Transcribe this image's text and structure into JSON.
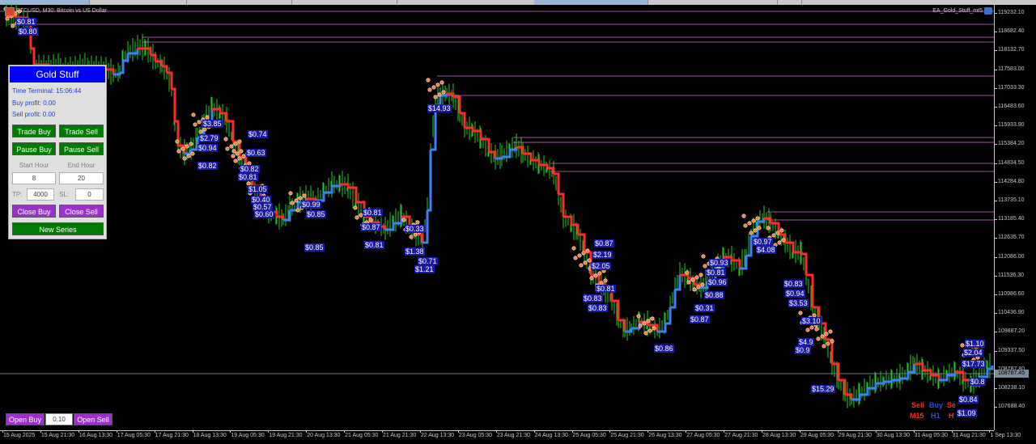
{
  "header": {
    "symbol": "BTCUSD, M30:  Bitcoin vs US Dollar",
    "ea_name": "EA_Gold_Stuff_mt5"
  },
  "colors": {
    "background": "#000000",
    "up_line": "#3b82f6",
    "down_line": "#ff2a2a",
    "candles": "#22cc22",
    "level_lines": "#d070d0",
    "current_price_line": "#6a7a8a",
    "panel_title_bg": "#0000ff",
    "green_button": "#007a00",
    "purple_button": "#9932cc",
    "profit_tag_bg": "#1a1aa0"
  },
  "price_axis": {
    "labels": [
      "119232.10",
      "118682.40",
      "118132.70",
      "117583.00",
      "117033.30",
      "116483.60",
      "115933.90",
      "115384.20",
      "114834.50",
      "114284.80",
      "113735.10",
      "113185.40",
      "112635.70",
      "112086.00",
      "111536.30",
      "110986.60",
      "110436.90",
      "109887.20",
      "109337.50",
      "108787.80",
      "108238.10",
      "107688.40"
    ],
    "current_price": "108787.45"
  },
  "time_axis": {
    "labels": [
      "15 Aug 2025",
      "15 Aug 21:30",
      "16 Aug 13:30",
      "17 Aug 05:30",
      "17 Aug 21:30",
      "18 Aug 13:30",
      "19 Aug 05:30",
      "19 Aug 21:30",
      "20 Aug 13:30",
      "21 Aug 05:30",
      "21 Aug 21:30",
      "22 Aug 13:30",
      "23 Aug 05:30",
      "23 Aug 21:30",
      "24 Aug 13:30",
      "25 Aug 05:30",
      "25 Aug 21:30",
      "26 Aug 13:30",
      "27 Aug 05:30",
      "27 Aug 21:30",
      "28 Aug 13:30",
      "29 Aug 05:30",
      "29 Aug 21:30",
      "30 Aug 13:30",
      "31 Aug 05:30",
      "31 Aug 21:30",
      "1 Sep 13:30"
    ]
  },
  "panel": {
    "title": "Gold Stuff",
    "time_terminal": "Time Terminal: 15:06:44",
    "buy_profit": "Buy profit: 0.00",
    "sell_profit": "Sell profit: 0.00",
    "trade_buy": "Trade Buy",
    "trade_sell": "Trade Sell",
    "pause_buy": "Pause Buy",
    "pause_sell": "Pause Sell",
    "start_hour_label": "Start Hour",
    "end_hour_label": "End Hour",
    "start_hour": "8",
    "end_hour": "20",
    "tp_label": "TP:",
    "tp_value": "4000",
    "sl_label": "SL:",
    "sl_value": "0",
    "close_buy": "Close Buy",
    "close_sell": "Close Sell",
    "new_series": "New Series"
  },
  "bottom": {
    "open_buy": "Open Buy",
    "lot": "0.10",
    "open_sell": "Open Sell"
  },
  "legend": {
    "sell": "Sell",
    "buy": "Buy",
    "se": "Se",
    "m15": "M15",
    "h1": "H1",
    "h": "H"
  },
  "profit_tags": [
    {
      "text": "$0.81"
    },
    {
      "text": "$0.80"
    },
    {
      "text": "$3.85"
    },
    {
      "text": "$2.79"
    },
    {
      "text": "$0.94"
    },
    {
      "text": "$0.82"
    },
    {
      "text": "$0.74"
    },
    {
      "text": "$0.63"
    },
    {
      "text": "$0.82"
    },
    {
      "text": "$0.81"
    },
    {
      "text": "$1.05"
    },
    {
      "text": "$0.40"
    },
    {
      "text": "$0.57"
    },
    {
      "text": "$0.60"
    },
    {
      "text": "$0.99"
    },
    {
      "text": "$0.85"
    },
    {
      "text": "$0.85"
    },
    {
      "text": "$0.81"
    },
    {
      "text": "$0.87"
    },
    {
      "text": "$0.81"
    },
    {
      "text": "$0.33"
    },
    {
      "text": "$1.38"
    },
    {
      "text": "$0.71"
    },
    {
      "text": "$1.21"
    },
    {
      "text": "$14.93"
    },
    {
      "text": "$0.87"
    },
    {
      "text": "$2.19"
    },
    {
      "text": "$2.05"
    },
    {
      "text": "$0.81"
    },
    {
      "text": "$0.83"
    },
    {
      "text": "$0.83"
    },
    {
      "text": "$0.86"
    },
    {
      "text": "$0.93"
    },
    {
      "text": "$0.81"
    },
    {
      "text": "$0.96"
    },
    {
      "text": "$0.88"
    },
    {
      "text": "$0.31"
    },
    {
      "text": "$0.87"
    },
    {
      "text": "$0.97"
    },
    {
      "text": "$4.08"
    },
    {
      "text": "$0.83"
    },
    {
      "text": "$0.94"
    },
    {
      "text": "$3.53"
    },
    {
      "text": "$3.10"
    },
    {
      "text": "$4.9"
    },
    {
      "text": "$0.9"
    },
    {
      "text": "$15.29"
    },
    {
      "text": "$1.10"
    },
    {
      "text": "$2.04"
    },
    {
      "text": "$17.73"
    },
    {
      "text": "$0.8"
    },
    {
      "text": "$0.84"
    },
    {
      "text": "$1.09"
    }
  ]
}
